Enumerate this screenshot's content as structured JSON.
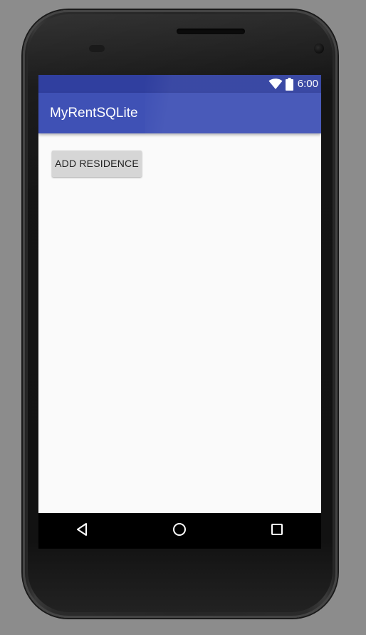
{
  "status_bar": {
    "time": "6:00",
    "icons": [
      "wifi-icon",
      "battery-icon"
    ],
    "color": "#303f9f"
  },
  "app_bar": {
    "title": "MyRentSQLite",
    "color": "#3f51b5"
  },
  "main": {
    "add_button_label": "ADD RESIDENCE"
  },
  "nav_bar": {
    "items": [
      "back-icon",
      "home-icon",
      "recents-icon"
    ]
  }
}
